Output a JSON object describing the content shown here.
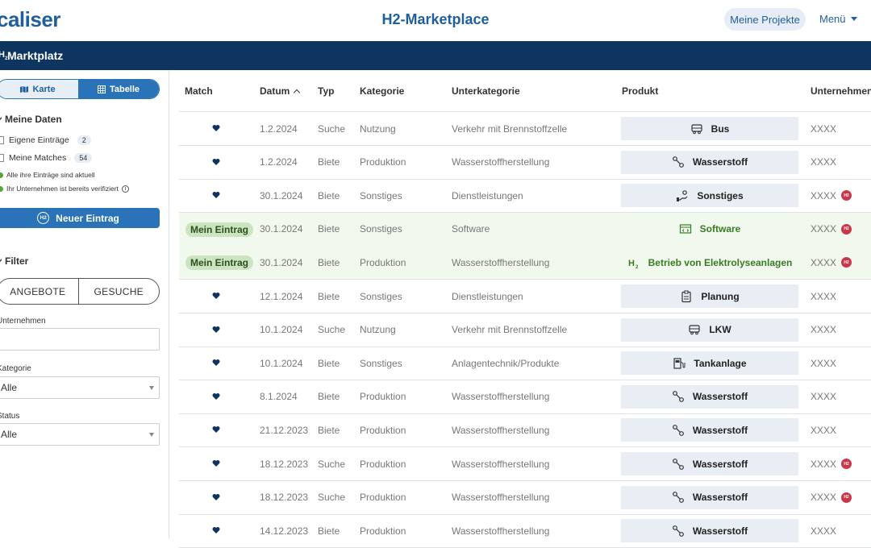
{
  "header": {
    "logo": "caliser",
    "title": "H2-Marketplace",
    "projects_label": "Meine Projekte",
    "menu_label": "Menü"
  },
  "band": {
    "icon": "H2",
    "title": "Marktplatz"
  },
  "sidebar": {
    "view_toggle": {
      "map_label": "Karte",
      "table_label": "Tabelle",
      "selected": "Tabelle"
    },
    "my_data": {
      "title": "Meine Daten",
      "own_entries_label": "Eigene Einträge",
      "own_entries_count": "2",
      "my_matches_label": "Meine Matches",
      "my_matches_count": "54",
      "status_1": "Alle ihre Einträge sind aktuell",
      "status_2": "Ihr Unternehmen ist bereits verifiziert"
    },
    "new_entry_label": "Neuer Eintrag",
    "filter": {
      "title": "Filter",
      "offers_label": "ANGEBOTE",
      "requests_label": "GESUCHE",
      "company_label": "Unternehmen",
      "company_value": "",
      "category_label": "Kategorie",
      "category_value": "Alle",
      "status_label": "Status",
      "status_value": "Alle"
    }
  },
  "table": {
    "headers": {
      "match": "Match",
      "date": "Datum",
      "type": "Typ",
      "category": "Kategorie",
      "subcategory": "Unterkategorie",
      "product": "Produkt",
      "company": "Unternehmen"
    },
    "mine_label": "Mein Eintrag",
    "rows": [
      {
        "mine": false,
        "date": "1.2.2024",
        "type": "Suche",
        "category": "Nutzung",
        "subcategory": "Verkehr mit Brennstoffzelle",
        "product": "Bus",
        "icon": "bus-icon",
        "company": "XXXX",
        "badge": false
      },
      {
        "mine": false,
        "date": "1.2.2024",
        "type": "Biete",
        "category": "Produktion",
        "subcategory": "Wasserstoffherstellung",
        "product": "Wasserstoff",
        "icon": "molecule-icon",
        "company": "XXXX",
        "badge": false
      },
      {
        "mine": false,
        "date": "30.1.2024",
        "type": "Biete",
        "category": "Sonstiges",
        "subcategory": "Dienstleistungen",
        "product": "Sonstiges",
        "icon": "hand-service-icon",
        "company": "XXXX",
        "badge": true
      },
      {
        "mine": true,
        "date": "30.1.2024",
        "type": "Biete",
        "category": "Sonstiges",
        "subcategory": "Software",
        "product": "Software",
        "icon": "software-icon",
        "company": "XXXX",
        "badge": true
      },
      {
        "mine": true,
        "date": "30.1.2024",
        "type": "Biete",
        "category": "Produktion",
        "subcategory": "Wasserstoffherstellung",
        "product": "Betrieb von Elektrolyseanlagen",
        "icon": "h2-icon",
        "company": "XXXX",
        "badge": true
      },
      {
        "mine": false,
        "date": "12.1.2024",
        "type": "Biete",
        "category": "Sonstiges",
        "subcategory": "Dienstleistungen",
        "product": "Planung",
        "icon": "clipboard-icon",
        "company": "XXXX",
        "badge": false
      },
      {
        "mine": false,
        "date": "10.1.2024",
        "type": "Suche",
        "category": "Nutzung",
        "subcategory": "Verkehr mit Brennstoffzelle",
        "product": "LKW",
        "icon": "truck-icon",
        "company": "XXXX",
        "badge": false
      },
      {
        "mine": false,
        "date": "10.1.2024",
        "type": "Biete",
        "category": "Sonstiges",
        "subcategory": "Anlagentechnik/Produkte",
        "product": "Tankanlage",
        "icon": "fuel-station-icon",
        "company": "XXXX",
        "badge": false
      },
      {
        "mine": false,
        "date": "8.1.2024",
        "type": "Biete",
        "category": "Produktion",
        "subcategory": "Wasserstoffherstellung",
        "product": "Wasserstoff",
        "icon": "molecule-icon",
        "company": "XXXX",
        "badge": false
      },
      {
        "mine": false,
        "date": "21.12.2023",
        "type": "Biete",
        "category": "Produktion",
        "subcategory": "Wasserstoffherstellung",
        "product": "Wasserstoff",
        "icon": "molecule-icon",
        "company": "XXXX",
        "badge": false
      },
      {
        "mine": false,
        "date": "18.12.2023",
        "type": "Suche",
        "category": "Produktion",
        "subcategory": "Wasserstoffherstellung",
        "product": "Wasserstoff",
        "icon": "molecule-icon",
        "company": "XXXX",
        "badge": true
      },
      {
        "mine": false,
        "date": "18.12.2023",
        "type": "Suche",
        "category": "Produktion",
        "subcategory": "Wasserstoffherstellung",
        "product": "Wasserstoff",
        "icon": "molecule-icon",
        "company": "XXXX",
        "badge": true
      },
      {
        "mine": false,
        "date": "14.12.2023",
        "type": "Biete",
        "category": "Produktion",
        "subcategory": "Wasserstoffherstellung",
        "product": "Wasserstoff",
        "icon": "molecule-icon",
        "company": "XXXX",
        "badge": false
      }
    ]
  },
  "colors": {
    "brand": "#1f5f9d",
    "band": "#0d355f",
    "accent": "#2b73b8",
    "mine_row": "#f1f8ee",
    "badge": "#c9384a"
  }
}
